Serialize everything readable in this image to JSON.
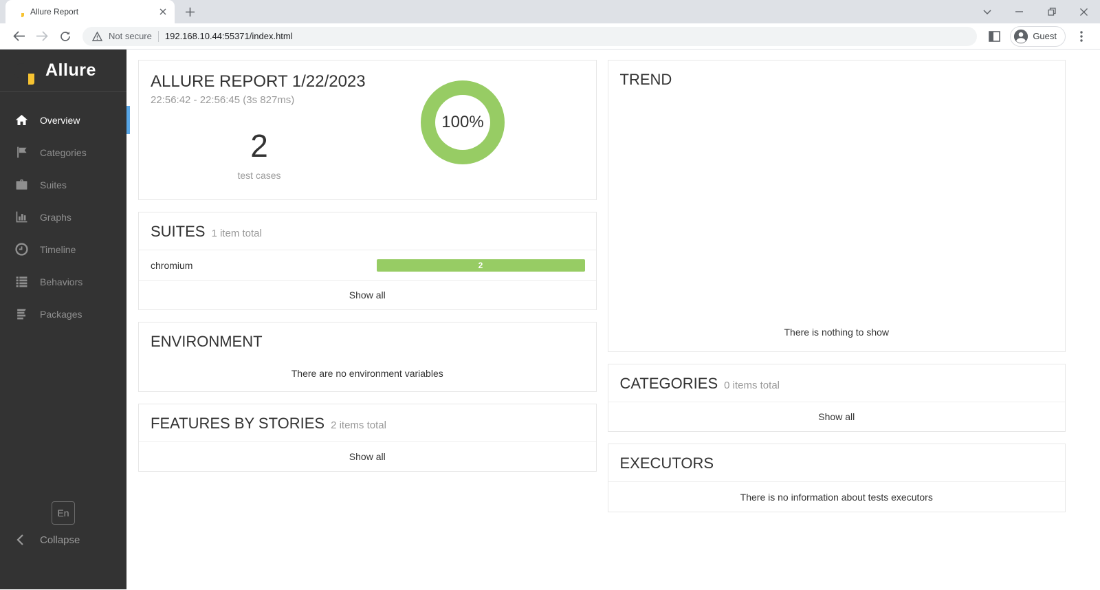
{
  "browser": {
    "tab_title": "Allure Report",
    "security_label": "Not secure",
    "url": "192.168.10.44:55371/index.html",
    "profile_label": "Guest"
  },
  "sidebar": {
    "brand": "Allure",
    "items": [
      {
        "label": "Overview",
        "icon": "home-icon",
        "active": true
      },
      {
        "label": "Categories",
        "icon": "flag-icon",
        "active": false
      },
      {
        "label": "Suites",
        "icon": "briefcase-icon",
        "active": false
      },
      {
        "label": "Graphs",
        "icon": "bar-chart-icon",
        "active": false
      },
      {
        "label": "Timeline",
        "icon": "clock-icon",
        "active": false
      },
      {
        "label": "Behaviors",
        "icon": "list-icon",
        "active": false
      },
      {
        "label": "Packages",
        "icon": "layers-icon",
        "active": false
      }
    ],
    "language_label": "En",
    "collapse_label": "Collapse"
  },
  "overview": {
    "title": "ALLURE REPORT 1/22/2023",
    "subtitle": "22:56:42 - 22:56:45 (3s 827ms)",
    "total_count": "2",
    "total_label": "test cases",
    "percent": "100%"
  },
  "suites": {
    "title": "SUITES",
    "total": "1 item total",
    "rows": [
      {
        "name": "chromium",
        "passed": "2"
      }
    ],
    "show_all": "Show all"
  },
  "environment": {
    "title": "ENVIRONMENT",
    "empty": "There are no environment variables"
  },
  "features": {
    "title": "FEATURES BY STORIES",
    "total": "2 items total",
    "show_all": "Show all"
  },
  "trend": {
    "title": "TREND",
    "empty": "There is nothing to show"
  },
  "categories": {
    "title": "CATEGORIES",
    "total": "0 items total",
    "show_all": "Show all"
  },
  "executors": {
    "title": "EXECUTORS",
    "empty": "There is no information about tests executors"
  },
  "colors": {
    "passed_green": "#97cc64",
    "active_blue": "#58a6e6",
    "sidebar_bg": "#333333",
    "logo_red": "#e8544f",
    "logo_magenta": "#bf5dc0",
    "logo_yellow": "#f7c331",
    "logo_gray": "#a5a5a5",
    "logo_green": "#7db543"
  }
}
